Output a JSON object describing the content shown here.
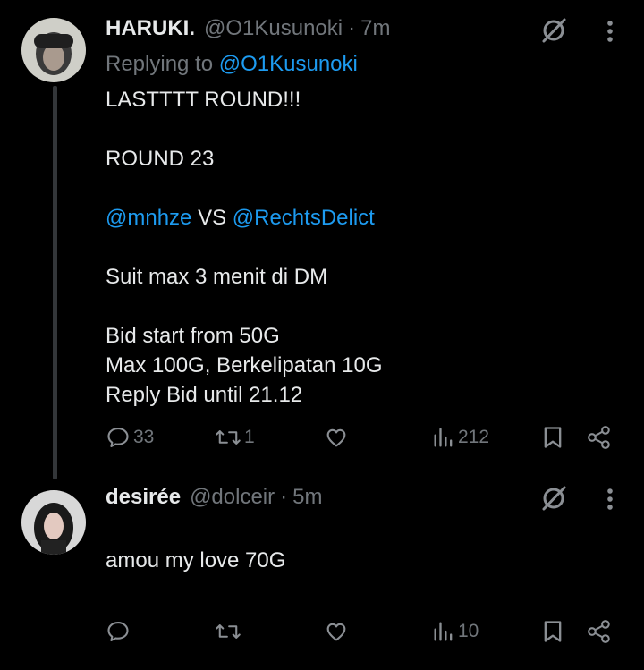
{
  "tweets": [
    {
      "name": "HARUKI.",
      "handle": "@O1Kusunoki",
      "time": "7m",
      "replying_label": "Replying to",
      "replying_handle": "@O1Kusunoki",
      "body_line1": "LASTTTT ROUND!!!",
      "body_line2": "ROUND 23",
      "mention_a": "@mnhze",
      "vs": " VS ",
      "mention_b": "@RechtsDelict",
      "body_line4": "Suit max 3 menit di DM",
      "body_line5": "Bid start from 50G\nMax 100G, Berkelipatan 10G\nReply Bid until 21.12",
      "replies": "33",
      "retweets": "1",
      "likes": "",
      "views": "212"
    },
    {
      "name": "desirée",
      "handle": "@dolceir",
      "time": "5m",
      "body": "amou my love 70G",
      "replies": "",
      "retweets": "",
      "likes": "",
      "views": "10"
    }
  ],
  "separator": "·",
  "icons": [
    "grok-icon",
    "more-vertical-icon",
    "reply-icon",
    "retweet-icon",
    "like-icon",
    "views-icon",
    "bookmark-icon",
    "share-icon"
  ],
  "colors": {
    "background": "#000000",
    "text": "#e7e9ea",
    "muted": "#71767b",
    "link": "#1d9bf0"
  }
}
